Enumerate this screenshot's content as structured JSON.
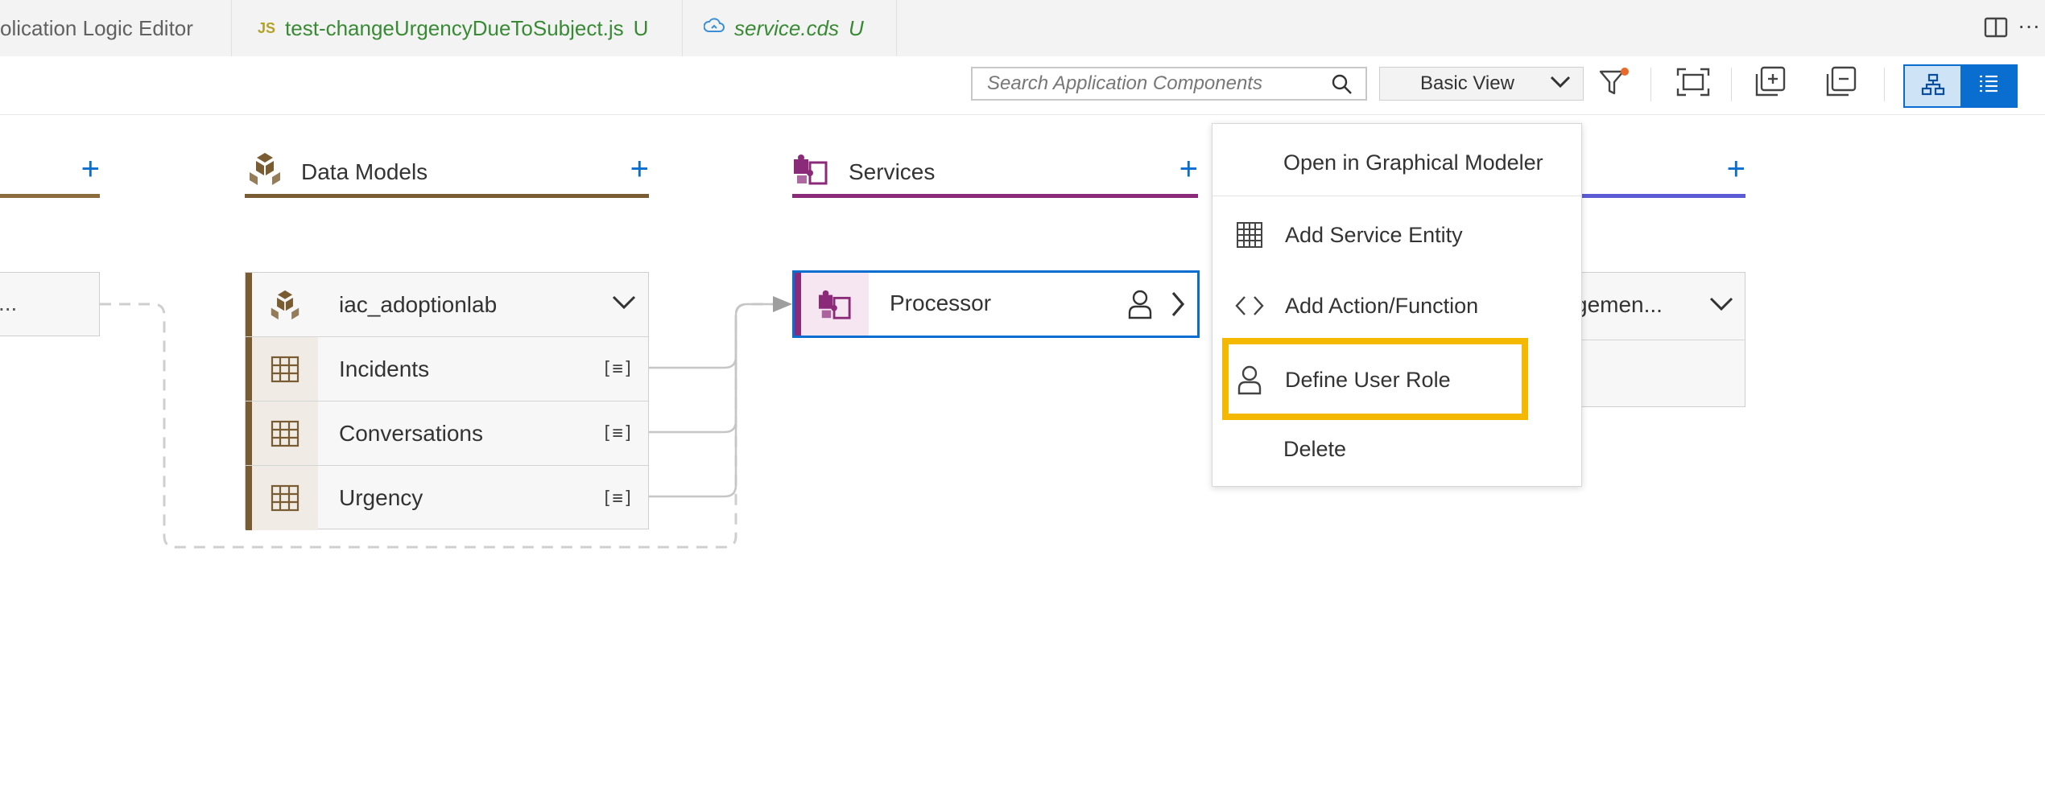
{
  "tabs": [
    {
      "label": "olication Logic Editor",
      "icon": "",
      "badge": "",
      "style": "grey"
    },
    {
      "label": "test-changeUrgencyDueToSubject.js",
      "icon": "JS",
      "badge": "U",
      "style": "green"
    },
    {
      "label": "service.cds",
      "icon": "cloud-cds-icon",
      "badge": "U",
      "style": "green-italic"
    }
  ],
  "toolbar": {
    "search_placeholder": "Search Application Components",
    "view_select": "Basic View"
  },
  "columns": {
    "data_models": {
      "label": "Data Models",
      "color": "#7a5c33"
    },
    "services": {
      "label": "Services",
      "color": "#8c2a7a"
    },
    "right_color": "#5b5bd6",
    "left_color": "#8c6c3c"
  },
  "data_model_node": {
    "title": "iac_adoptionlab",
    "entities": [
      "Incidents",
      "Conversations",
      "Urgency"
    ]
  },
  "left_node": {
    "label": "..."
  },
  "service_node": {
    "title": "Processor"
  },
  "right_node": {
    "title": "gemen..."
  },
  "context_menu": {
    "items": [
      {
        "label": "Open in Graphical Modeler",
        "icon": ""
      },
      {
        "label": "Add Service Entity",
        "icon": "table-grid-icon"
      },
      {
        "label": "Add Action/Function",
        "icon": "code-brackets-icon"
      },
      {
        "label": "Define User Role",
        "icon": "user-icon"
      },
      {
        "label": "Delete",
        "icon": ""
      }
    ]
  },
  "colors": {
    "accent": "#0a6ed1",
    "highlight": "#f5b800"
  }
}
